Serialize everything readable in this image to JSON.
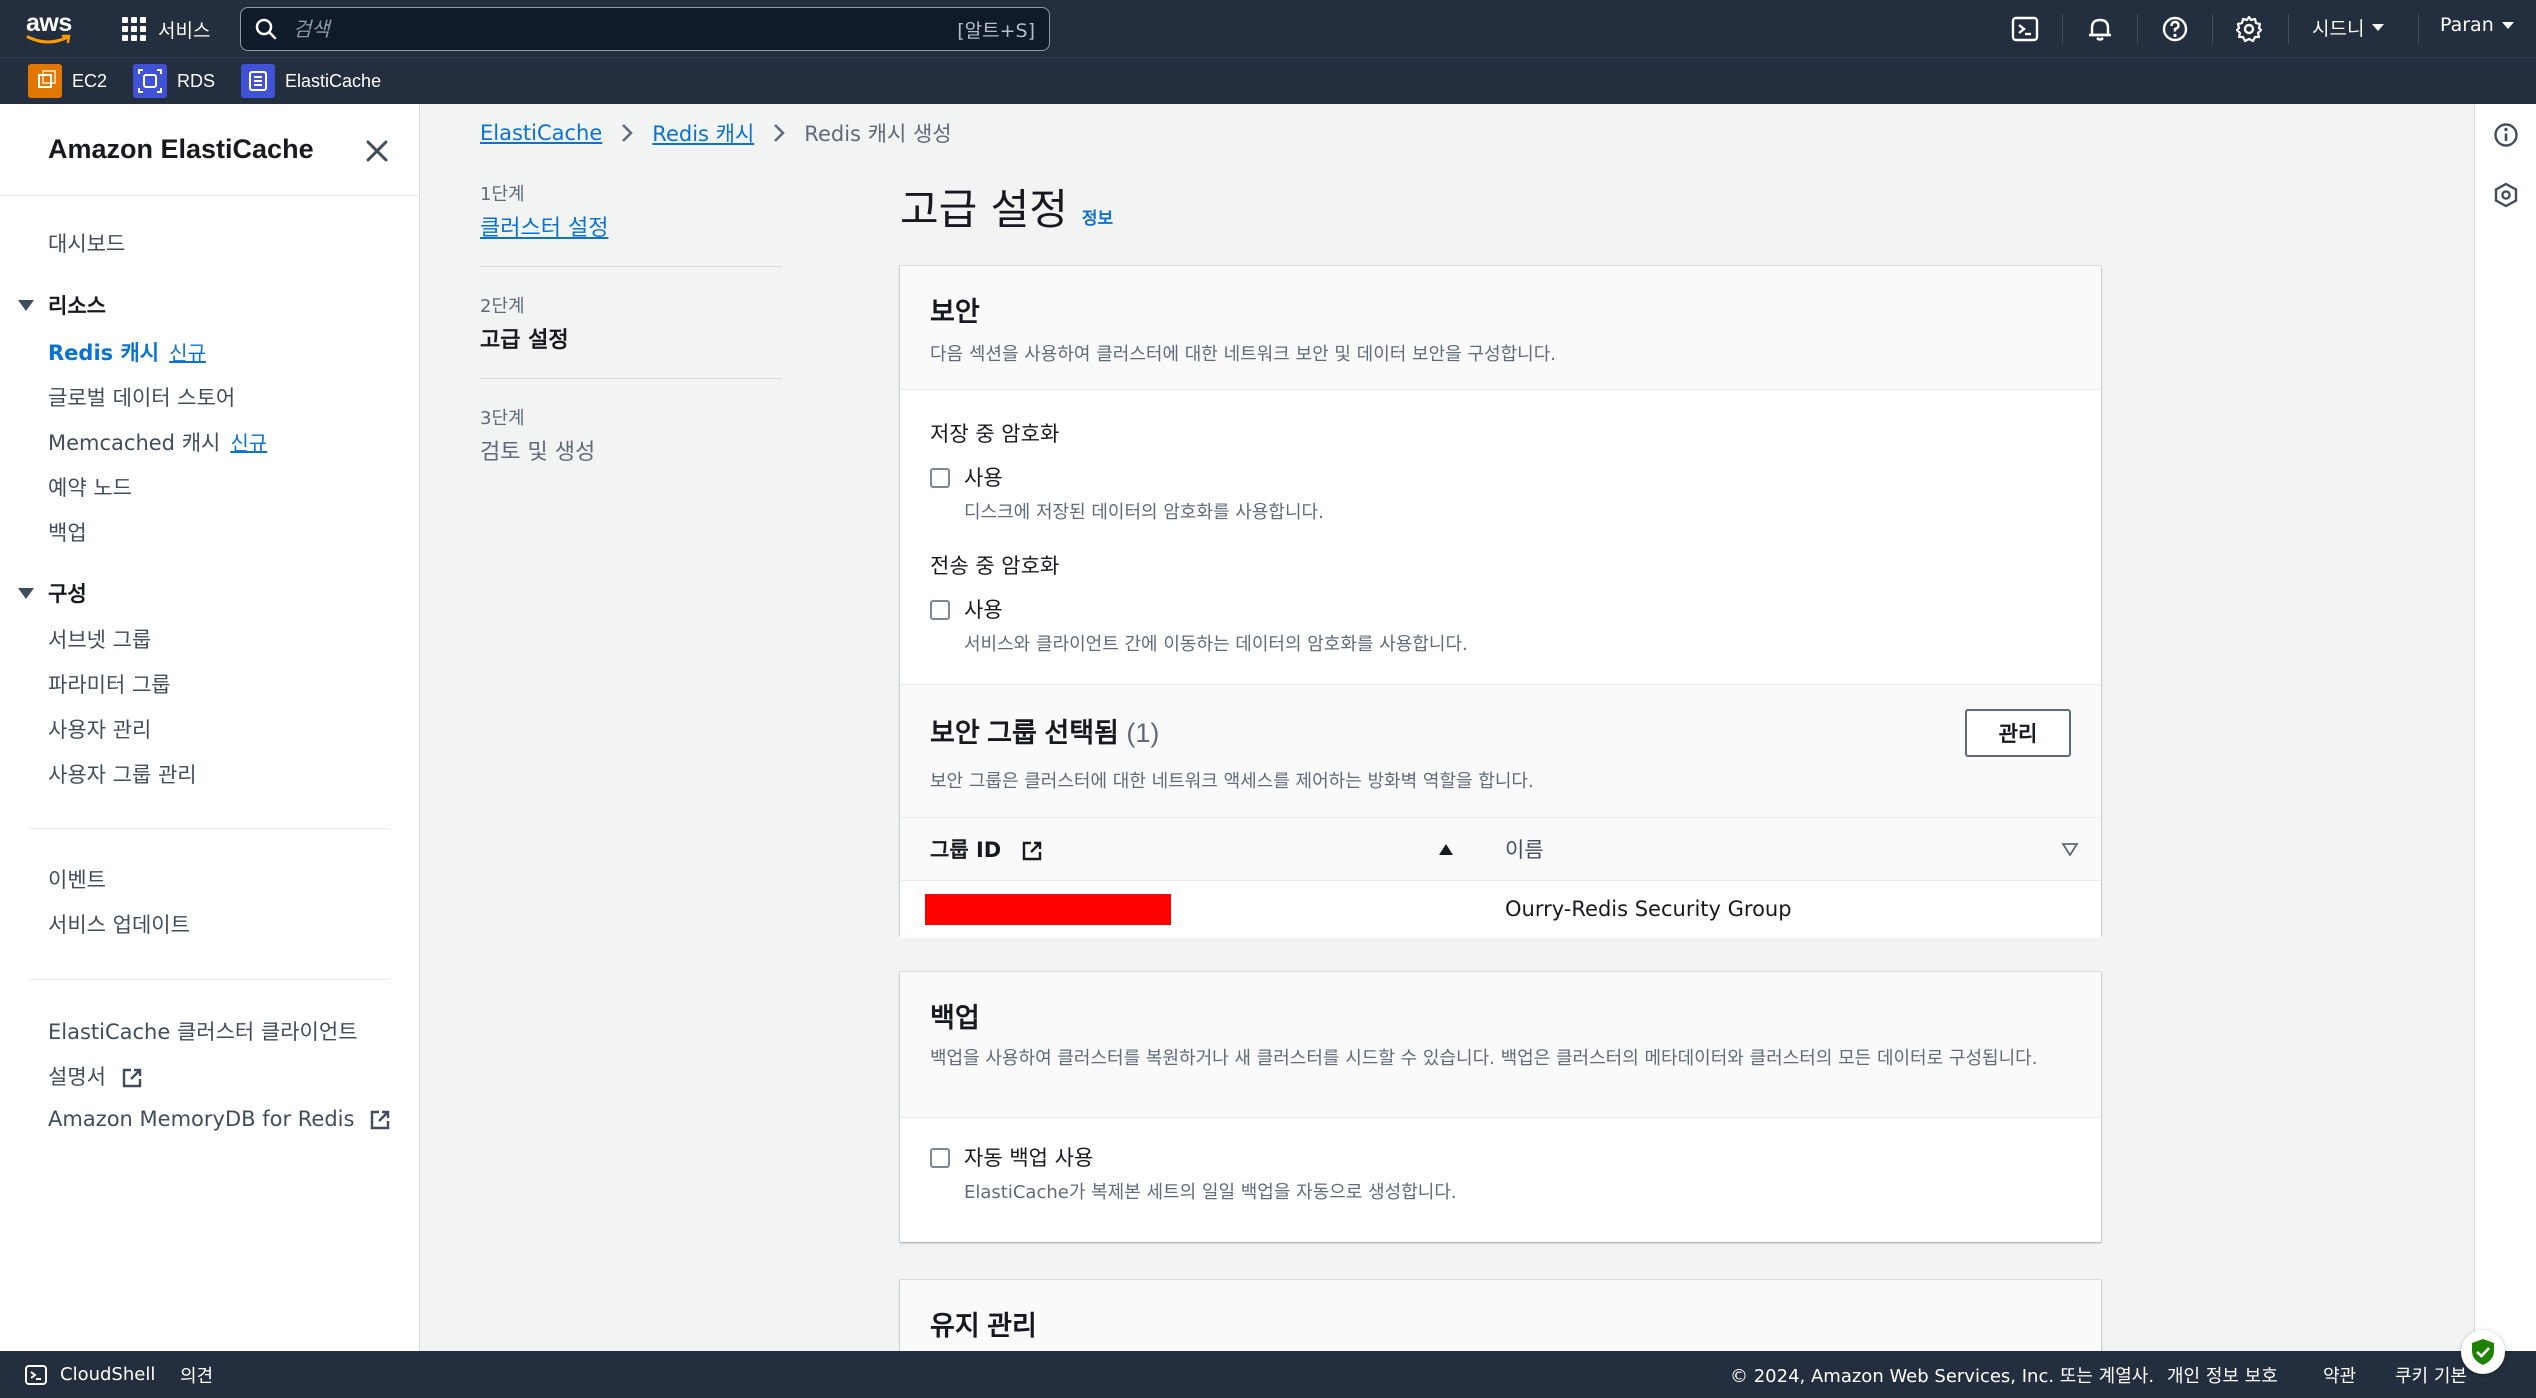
{
  "topbar": {
    "logo_text": "aws",
    "services_label": "서비스",
    "search_placeholder": "검색",
    "search_shortcut": "[알트+S]",
    "region": "시드니",
    "account": "Paran"
  },
  "favorites": [
    {
      "label": "EC2",
      "icon": "ec2-icon",
      "color": "#e07700"
    },
    {
      "label": "RDS",
      "icon": "rds-icon",
      "color": "#4053d6"
    },
    {
      "label": "ElastiCache",
      "icon": "elasticache-icon",
      "color": "#4053d6"
    }
  ],
  "sidenav": {
    "title": "Amazon ElastiCache",
    "dashboard": "대시보드",
    "resources_section": "리소스",
    "redis_caches": "Redis 캐시",
    "new_badge": "신규",
    "global_datastore": "글로벌 데이터 스토어",
    "memcached_caches": "Memcached 캐시",
    "reserved_nodes": "예약 노드",
    "backups": "백업",
    "config_section": "구성",
    "subnet_groups": "서브넷 그룹",
    "parameter_groups": "파라미터 그룹",
    "user_management": "사용자 관리",
    "user_group_management": "사용자 그룹 관리",
    "events": "이벤트",
    "service_updates": "서비스 업데이트",
    "cluster_client": "ElastiCache 클러스터 클라이언트",
    "documentation": "설명서",
    "memorydb": "Amazon MemoryDB for Redis"
  },
  "breadcrumb": {
    "root": "ElastiCache",
    "parent": "Redis 캐시",
    "current": "Redis 캐시 생성"
  },
  "steps": [
    {
      "label": "1단계",
      "name": "클러스터 설정",
      "state": "link"
    },
    {
      "label": "2단계",
      "name": "고급 설정",
      "state": "current"
    },
    {
      "label": "3단계",
      "name": "검토 및 생성",
      "state": "future"
    }
  ],
  "page": {
    "title": "고급 설정",
    "info": "정보"
  },
  "security": {
    "title": "보안",
    "description": "다음 섹션을 사용하여 클러스터에 대한 네트워크 보안 및 데이터 보안을 구성합니다.",
    "at_rest_label": "저장 중 암호화",
    "at_rest_option": "사용",
    "at_rest_desc": "디스크에 저장된 데이터의 암호화를 사용합니다.",
    "in_transit_label": "전송 중 암호화",
    "in_transit_option": "사용",
    "in_transit_desc": "서비스와 클라이언트 간에 이동하는 데이터의 암호화를 사용합니다."
  },
  "security_groups": {
    "title": "보안 그룹 선택됨",
    "count": "(1)",
    "description": "보안 그룹은 클러스터에 대한 네트워크 액세스를 제어하는 방화벽 역할을 합니다.",
    "manage_button": "관리",
    "col_group_id": "그룹 ID",
    "col_name": "이름",
    "rows": [
      {
        "group_id": "",
        "redacted": true,
        "name": "Ourry-Redis Security Group"
      }
    ],
    "redact_color": "#ff0000"
  },
  "backup": {
    "title": "백업",
    "description": "백업을 사용하여 클러스터를 복원하거나 새 클러스터를 시드할 수 있습니다. 백업은 클러스터의 메타데이터와 클러스터의 모든 데이터로 구성됩니다.",
    "auto_backup_label": "자동 백업 사용",
    "auto_backup_desc": "ElastiCache가 복제본 세트의 일일 백업을 자동으로 생성합니다."
  },
  "maintenance": {
    "title": "유지 관리"
  },
  "footer": {
    "cloudshell": "CloudShell",
    "feedback": "의견",
    "copyright": "© 2024, Amazon Web Services, Inc. 또는 계열사.",
    "privacy": "개인 정보 보호",
    "terms": "약관",
    "cookies": "쿠키 기본"
  },
  "colors": {
    "header_bg": "#232f3e",
    "link": "#0972d3",
    "shield_badge": "#1d8102"
  }
}
